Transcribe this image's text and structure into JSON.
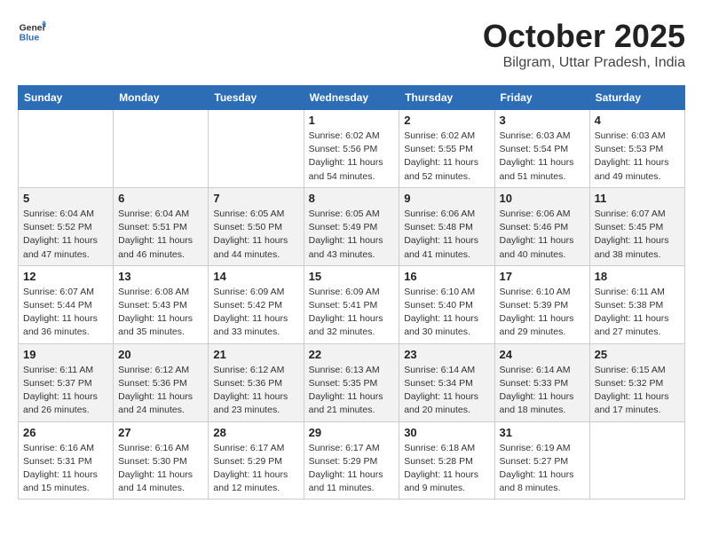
{
  "header": {
    "logo_general": "General",
    "logo_blue": "Blue",
    "month_year": "October 2025",
    "location": "Bilgram, Uttar Pradesh, India"
  },
  "weekdays": [
    "Sunday",
    "Monday",
    "Tuesday",
    "Wednesday",
    "Thursday",
    "Friday",
    "Saturday"
  ],
  "weeks": [
    [
      {
        "day": "",
        "info": ""
      },
      {
        "day": "",
        "info": ""
      },
      {
        "day": "",
        "info": ""
      },
      {
        "day": "1",
        "info": "Sunrise: 6:02 AM\nSunset: 5:56 PM\nDaylight: 11 hours\nand 54 minutes."
      },
      {
        "day": "2",
        "info": "Sunrise: 6:02 AM\nSunset: 5:55 PM\nDaylight: 11 hours\nand 52 minutes."
      },
      {
        "day": "3",
        "info": "Sunrise: 6:03 AM\nSunset: 5:54 PM\nDaylight: 11 hours\nand 51 minutes."
      },
      {
        "day": "4",
        "info": "Sunrise: 6:03 AM\nSunset: 5:53 PM\nDaylight: 11 hours\nand 49 minutes."
      }
    ],
    [
      {
        "day": "5",
        "info": "Sunrise: 6:04 AM\nSunset: 5:52 PM\nDaylight: 11 hours\nand 47 minutes."
      },
      {
        "day": "6",
        "info": "Sunrise: 6:04 AM\nSunset: 5:51 PM\nDaylight: 11 hours\nand 46 minutes."
      },
      {
        "day": "7",
        "info": "Sunrise: 6:05 AM\nSunset: 5:50 PM\nDaylight: 11 hours\nand 44 minutes."
      },
      {
        "day": "8",
        "info": "Sunrise: 6:05 AM\nSunset: 5:49 PM\nDaylight: 11 hours\nand 43 minutes."
      },
      {
        "day": "9",
        "info": "Sunrise: 6:06 AM\nSunset: 5:48 PM\nDaylight: 11 hours\nand 41 minutes."
      },
      {
        "day": "10",
        "info": "Sunrise: 6:06 AM\nSunset: 5:46 PM\nDaylight: 11 hours\nand 40 minutes."
      },
      {
        "day": "11",
        "info": "Sunrise: 6:07 AM\nSunset: 5:45 PM\nDaylight: 11 hours\nand 38 minutes."
      }
    ],
    [
      {
        "day": "12",
        "info": "Sunrise: 6:07 AM\nSunset: 5:44 PM\nDaylight: 11 hours\nand 36 minutes."
      },
      {
        "day": "13",
        "info": "Sunrise: 6:08 AM\nSunset: 5:43 PM\nDaylight: 11 hours\nand 35 minutes."
      },
      {
        "day": "14",
        "info": "Sunrise: 6:09 AM\nSunset: 5:42 PM\nDaylight: 11 hours\nand 33 minutes."
      },
      {
        "day": "15",
        "info": "Sunrise: 6:09 AM\nSunset: 5:41 PM\nDaylight: 11 hours\nand 32 minutes."
      },
      {
        "day": "16",
        "info": "Sunrise: 6:10 AM\nSunset: 5:40 PM\nDaylight: 11 hours\nand 30 minutes."
      },
      {
        "day": "17",
        "info": "Sunrise: 6:10 AM\nSunset: 5:39 PM\nDaylight: 11 hours\nand 29 minutes."
      },
      {
        "day": "18",
        "info": "Sunrise: 6:11 AM\nSunset: 5:38 PM\nDaylight: 11 hours\nand 27 minutes."
      }
    ],
    [
      {
        "day": "19",
        "info": "Sunrise: 6:11 AM\nSunset: 5:37 PM\nDaylight: 11 hours\nand 26 minutes."
      },
      {
        "day": "20",
        "info": "Sunrise: 6:12 AM\nSunset: 5:36 PM\nDaylight: 11 hours\nand 24 minutes."
      },
      {
        "day": "21",
        "info": "Sunrise: 6:12 AM\nSunset: 5:36 PM\nDaylight: 11 hours\nand 23 minutes."
      },
      {
        "day": "22",
        "info": "Sunrise: 6:13 AM\nSunset: 5:35 PM\nDaylight: 11 hours\nand 21 minutes."
      },
      {
        "day": "23",
        "info": "Sunrise: 6:14 AM\nSunset: 5:34 PM\nDaylight: 11 hours\nand 20 minutes."
      },
      {
        "day": "24",
        "info": "Sunrise: 6:14 AM\nSunset: 5:33 PM\nDaylight: 11 hours\nand 18 minutes."
      },
      {
        "day": "25",
        "info": "Sunrise: 6:15 AM\nSunset: 5:32 PM\nDaylight: 11 hours\nand 17 minutes."
      }
    ],
    [
      {
        "day": "26",
        "info": "Sunrise: 6:16 AM\nSunset: 5:31 PM\nDaylight: 11 hours\nand 15 minutes."
      },
      {
        "day": "27",
        "info": "Sunrise: 6:16 AM\nSunset: 5:30 PM\nDaylight: 11 hours\nand 14 minutes."
      },
      {
        "day": "28",
        "info": "Sunrise: 6:17 AM\nSunset: 5:29 PM\nDaylight: 11 hours\nand 12 minutes."
      },
      {
        "day": "29",
        "info": "Sunrise: 6:17 AM\nSunset: 5:29 PM\nDaylight: 11 hours\nand 11 minutes."
      },
      {
        "day": "30",
        "info": "Sunrise: 6:18 AM\nSunset: 5:28 PM\nDaylight: 11 hours\nand 9 minutes."
      },
      {
        "day": "31",
        "info": "Sunrise: 6:19 AM\nSunset: 5:27 PM\nDaylight: 11 hours\nand 8 minutes."
      },
      {
        "day": "",
        "info": ""
      }
    ]
  ]
}
